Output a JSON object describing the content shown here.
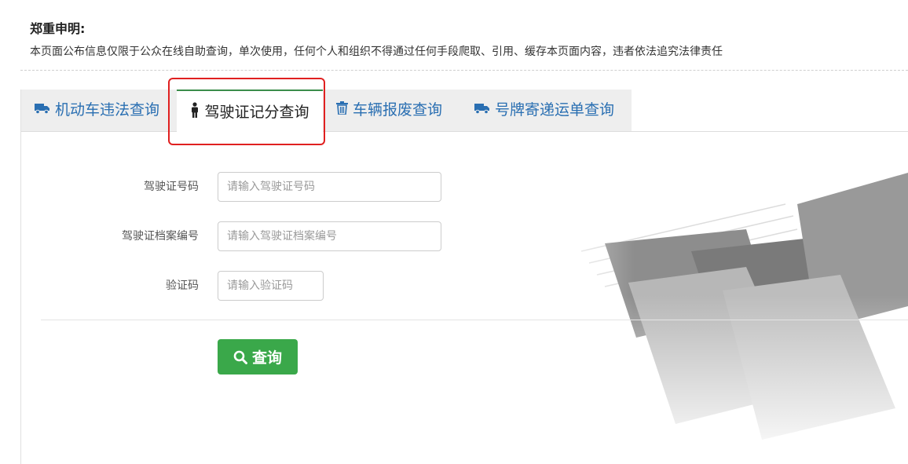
{
  "notice": {
    "title": "郑重申明:",
    "text": "本页面公布信息仅限于公众在线自助查询，单次使用，任何个人和组织不得通过任何手段爬取、引用、缓存本页面内容，违者依法追究法律责任"
  },
  "tabs": [
    {
      "label": "机动车违法查询",
      "icon": "truck-icon",
      "active": false
    },
    {
      "label": "驾驶证记分查询",
      "icon": "person-icon",
      "active": true
    },
    {
      "label": "车辆报废查询",
      "icon": "trash-icon",
      "active": false
    },
    {
      "label": "号牌寄递运单查询",
      "icon": "truck-icon",
      "active": false
    }
  ],
  "form": {
    "license_no": {
      "label": "驾驶证号码",
      "placeholder": "请输入驾驶证号码",
      "value": ""
    },
    "archive_no": {
      "label": "驾驶证档案编号",
      "placeholder": "请输入驾驶证档案编号",
      "value": ""
    },
    "captcha": {
      "label": "验证码",
      "placeholder": "请输入验证码",
      "value": ""
    },
    "submit_label": "查询"
  },
  "colors": {
    "tab_text": "#2a6fb2",
    "active_tab_border": "#3b8d4b",
    "submit_bg": "#3aa84a",
    "highlight_box": "#e02020"
  }
}
